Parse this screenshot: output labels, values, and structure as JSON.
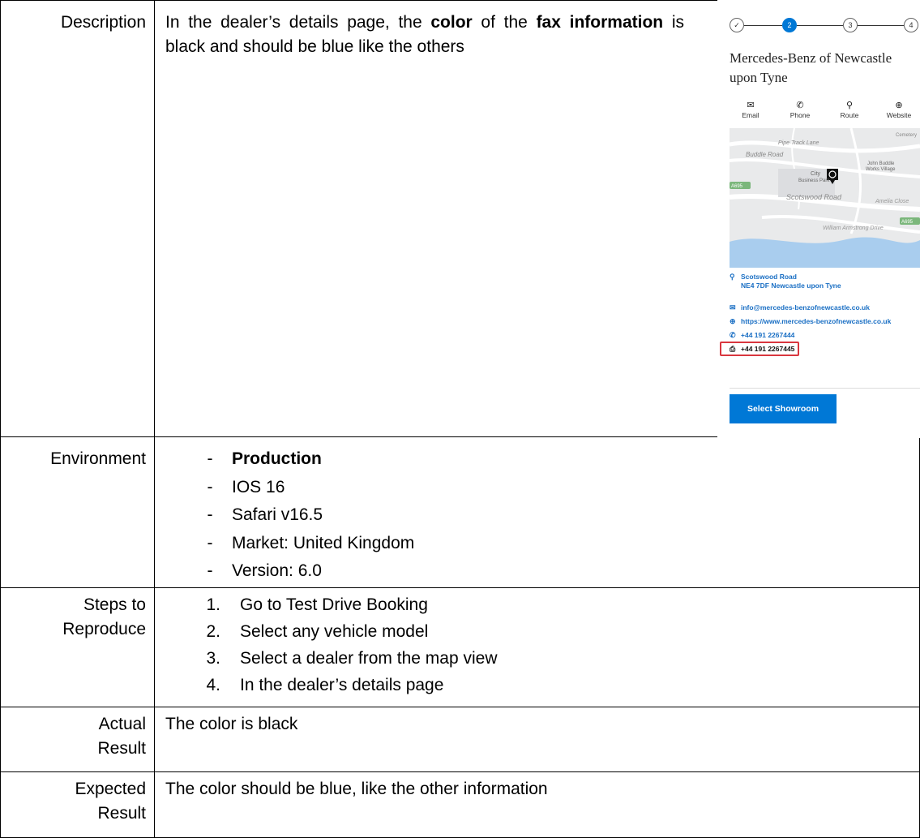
{
  "rows": {
    "description": {
      "label": "Description",
      "text_part1": "In the dealer’s details page, the ",
      "bold1": "color",
      "text_part2": " of the ",
      "bold2": "fax information",
      "text_part3": " is black and should be blue like the others"
    },
    "environment": {
      "label": "Environment",
      "marker": "-",
      "items": [
        "Production",
        "IOS 16",
        "Safari v16.5",
        "Market: United Kingdom",
        "Version: 6.0"
      ]
    },
    "steps": {
      "label_line1": "Steps to",
      "label_line2": "Reproduce",
      "items": [
        {
          "num": "1.",
          "text": "Go to Test Drive Booking"
        },
        {
          "num": "2.",
          "text": "Select any vehicle model"
        },
        {
          "num": "3.",
          "text": "Select a dealer from the map view"
        },
        {
          "num": "4.",
          "text": "In the dealer’s details page"
        }
      ]
    },
    "actual": {
      "label_line1": "Actual",
      "label_line2": "Result",
      "text": "The color is black"
    },
    "expected": {
      "label_line1": "Expected",
      "label_line2": "Result",
      "text": "The color should be blue, like the other information"
    }
  },
  "screenshot": {
    "stepper": {
      "step1": "✓",
      "step2": "2",
      "step3": "3",
      "step4": "4"
    },
    "dealer_name": "Mercedes-Benz of Newcastle upon Tyne",
    "actions": [
      {
        "label": "Email",
        "icon": "envelope-icon",
        "glyph": "✉"
      },
      {
        "label": "Phone",
        "icon": "phone-icon",
        "glyph": "✆"
      },
      {
        "label": "Route",
        "icon": "route-icon",
        "glyph": "⚲"
      },
      {
        "label": "Website",
        "icon": "globe-icon",
        "glyph": "⊕"
      }
    ],
    "map_labels": {
      "pipe_track": "Pipe Track Lane",
      "buddle_road": "Buddle Road",
      "john_buddle": "John Buddle",
      "works_village": "Works Village",
      "city": "City",
      "business_park": "Business Park",
      "scotswood_road": "Scotswood Road",
      "a695_left": "A695",
      "a695_right": "A695",
      "amelia": "Amelia Close",
      "cemetery": "Cemetery",
      "william": "William Armstrong Drive"
    },
    "address_line1": "Scotswood Road",
    "address_line2": "NE4 7DF Newcastle upon Tyne",
    "email": "info@mercedes-benzofnewcastle.co.uk",
    "website": "https://www.mercedes-benzofnewcastle.co.uk",
    "phone": "+44 191 2267444",
    "fax": "+44 191 2267445",
    "select_button": "Select Showroom",
    "colors": {
      "accent": "#0078d6",
      "link": "#1a6fc4",
      "highlight": "#d9363e"
    }
  }
}
